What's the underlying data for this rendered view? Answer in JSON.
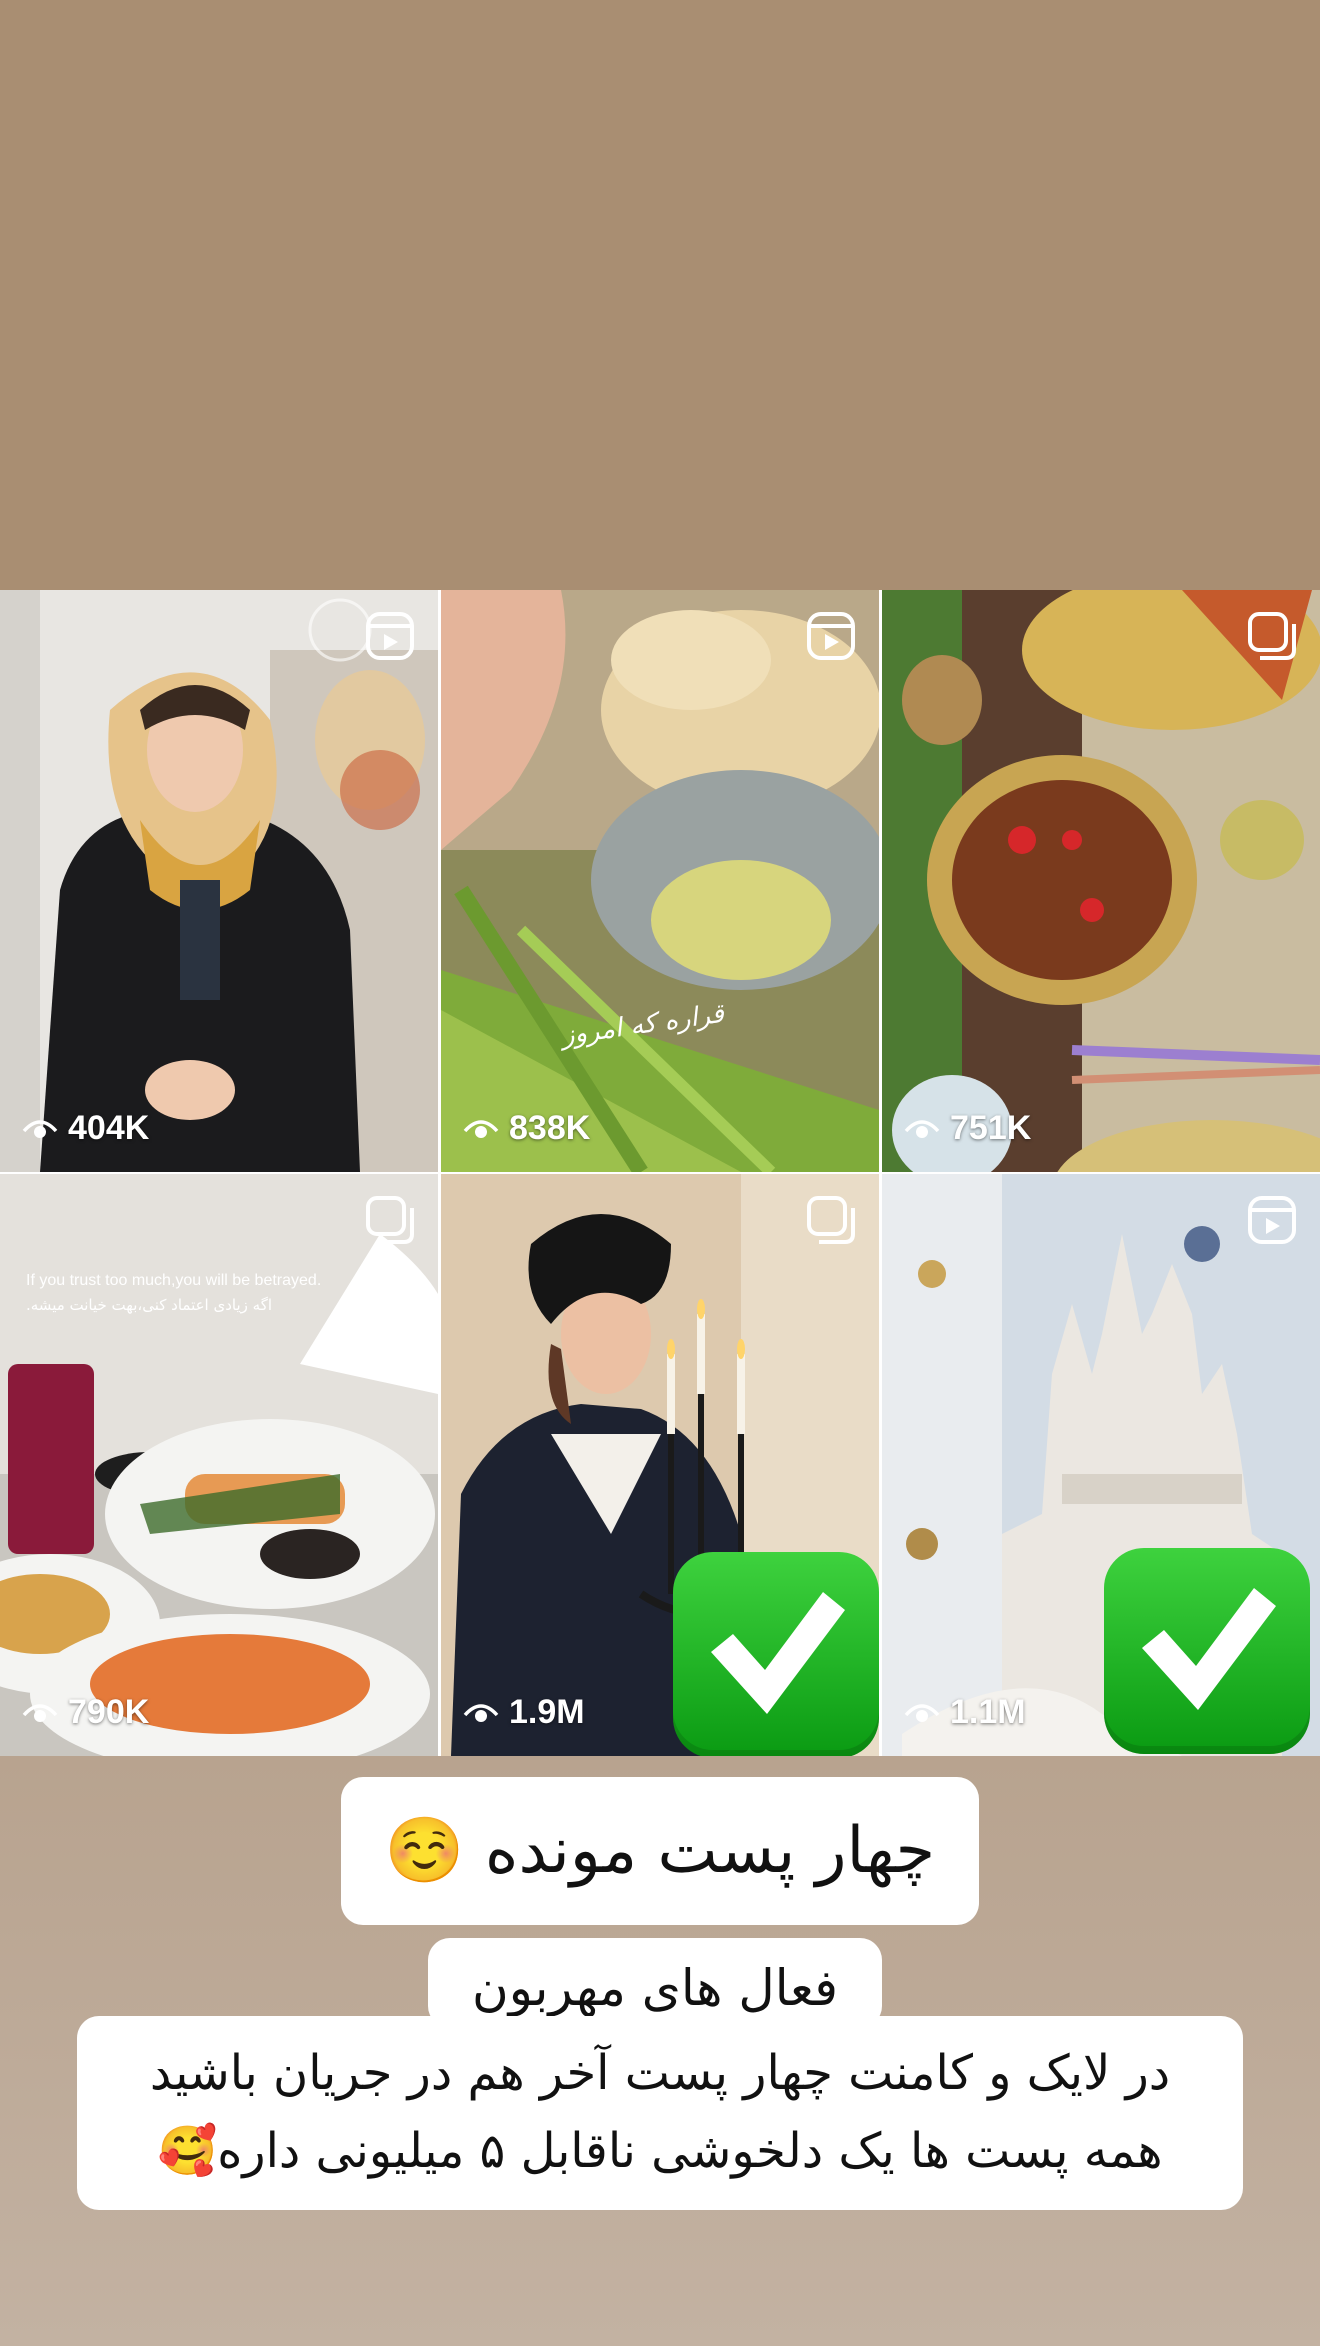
{
  "posts": [
    {
      "views": "404K",
      "type_icon": "reel-icon",
      "checked": false
    },
    {
      "views": "838K",
      "type_icon": "reel-icon",
      "checked": false,
      "overlay_text": "قراره که امروز"
    },
    {
      "views": "751K",
      "type_icon": "multi-post-icon",
      "checked": false
    },
    {
      "views": "790K",
      "type_icon": "multi-post-icon",
      "checked": false,
      "overlay_text_en": "If you trust too much,you will be betrayed.",
      "overlay_text_fa": "اگه زیادی اعتماد کنی،بهت خیانت میشه."
    },
    {
      "views": "1.9M",
      "type_icon": "multi-post-icon",
      "checked": true
    },
    {
      "views": "1.1M",
      "type_icon": "reel-icon",
      "checked": true
    }
  ],
  "caption_title": "چهار پست مونده ☺️",
  "caption_body": {
    "line1": "فعال های مهربون",
    "line2": "در لایک و کامنت چهار پست آخر هم در جریان باشید",
    "line3": "همه پست ها یک دلخوشی ناقابل ۵ میلیونی داره🥰"
  },
  "colors": {
    "top_background": "#a98e72",
    "check_green": "#12b01a",
    "caption_bg": "#ffffff"
  }
}
